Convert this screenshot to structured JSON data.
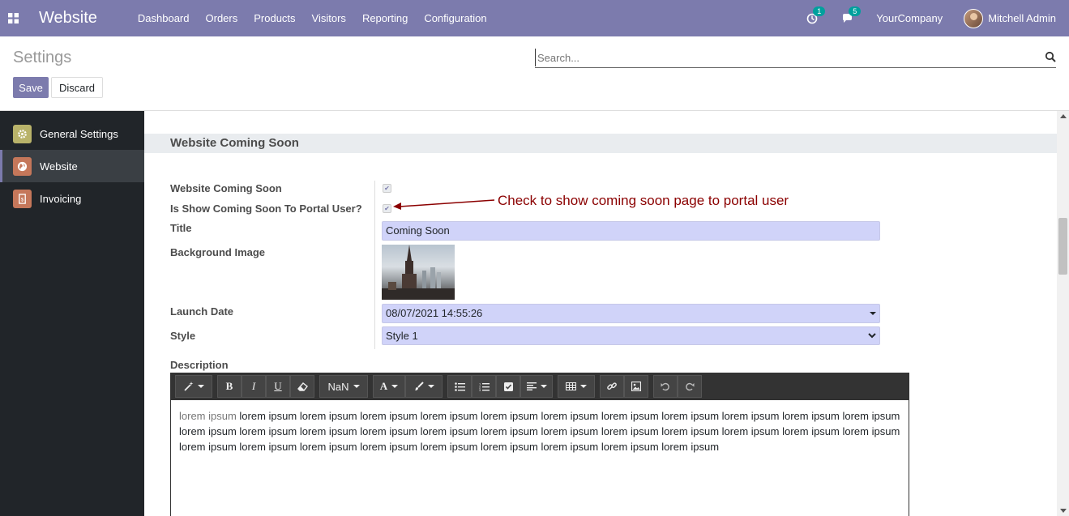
{
  "navbar": {
    "brand": "Website",
    "menu": [
      "Dashboard",
      "Orders",
      "Products",
      "Visitors",
      "Reporting",
      "Configuration"
    ],
    "activity_count": "1",
    "message_count": "5",
    "company": "YourCompany",
    "user": "Mitchell Admin"
  },
  "control": {
    "title": "Settings",
    "save_label": "Save",
    "discard_label": "Discard",
    "search_placeholder": "Search..."
  },
  "sidebar": {
    "items": [
      {
        "label": "General Settings",
        "color": "#b9b36a"
      },
      {
        "label": "Website",
        "color": "#c5775a"
      },
      {
        "label": "Invoicing",
        "color": "#c5775a"
      }
    ]
  },
  "section": {
    "title": "Website Coming Soon",
    "fields": {
      "coming_soon_label": "Website Coming Soon",
      "portal_label": "Is Show Coming Soon To Portal User?",
      "title_label": "Title",
      "title_value": "Coming Soon",
      "bg_label": "Background Image",
      "launch_label": "Launch Date",
      "launch_value": "08/07/2021 14:55:26",
      "style_label": "Style",
      "style_value": "Style 1",
      "description_label": "Description"
    },
    "annotation": "Check to show coming soon page to portal user"
  },
  "editor": {
    "font_size": "NaN",
    "body_faded": "lorem ipsum",
    "body_text": " lorem ipsum lorem ipsum lorem ipsum lorem ipsum lorem ipsum lorem ipsum lorem ipsum lorem ipsum lorem ipsum lorem ipsum lorem ipsum lorem ipsum lorem ipsum lorem ipsum lorem ipsum lorem ipsum lorem ipsum lorem ipsum lorem ipsum lorem ipsum lorem ipsum lorem ipsum lorem ipsum lorem ipsum lorem ipsum lorem ipsum lorem ipsum lorem ipsum lorem ipsum lorem ipsum lorem ipsum lorem ipsum"
  }
}
